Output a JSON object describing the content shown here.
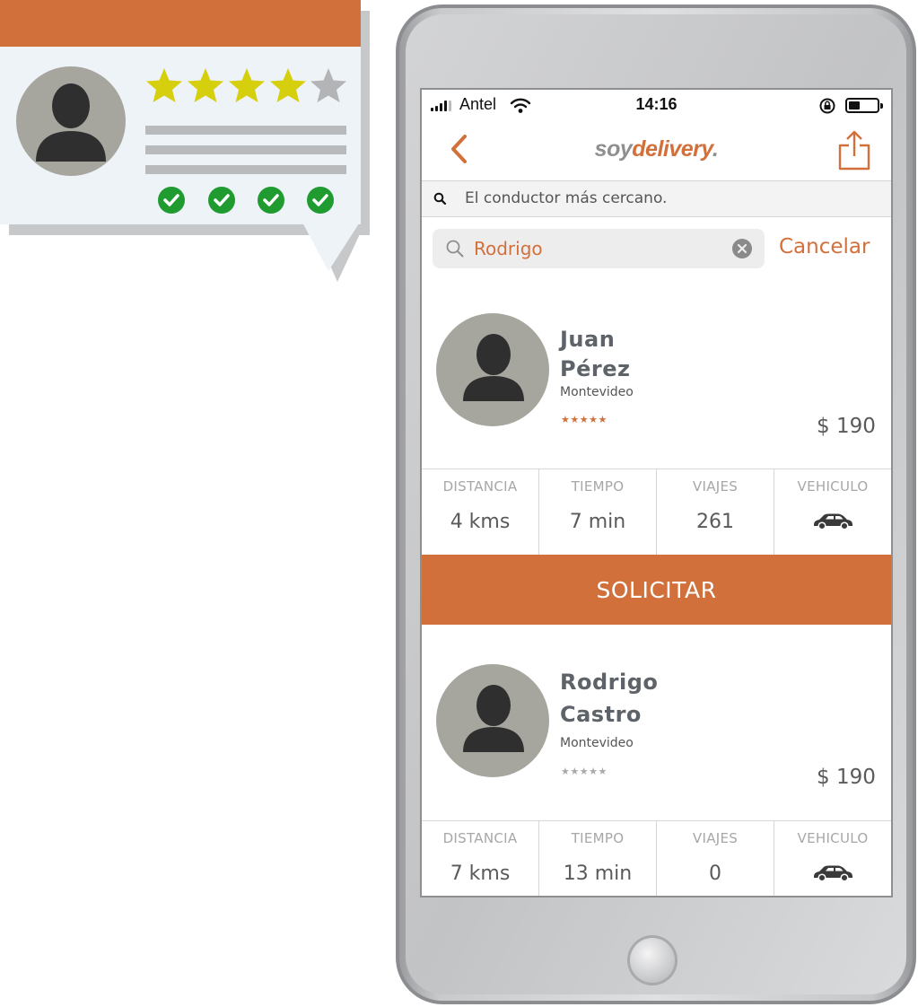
{
  "status_bar": {
    "carrier": "Antel",
    "time": "14:16"
  },
  "nav": {
    "logo_part1": "soy",
    "logo_part2": "delivery",
    "logo_mark": "."
  },
  "hint": {
    "text": "El conductor más cercano."
  },
  "search": {
    "value": "Rodrigo",
    "cancel_label": "Cancelar"
  },
  "drivers": [
    {
      "first_name": "Juan",
      "last_name": "Pérez",
      "city": "Montevideo",
      "rating": 5,
      "stars_text": "★★★★★",
      "star_color": "#d2703c",
      "price": "$ 190",
      "stats": [
        {
          "label": "DISTANCIA",
          "value": "4 kms"
        },
        {
          "label": "TIEMPO",
          "value": "7 min"
        },
        {
          "label": "VIAJES",
          "value": "261"
        },
        {
          "label": "VEHICULO",
          "icon": "car-icon"
        }
      ]
    },
    {
      "first_name": "Rodrigo",
      "last_name": "Castro",
      "city": "Montevideo",
      "rating": 0,
      "stars_text": "★★★★★",
      "star_color": "#a9a9a9",
      "price": "$ 190",
      "stats": [
        {
          "label": "DISTANCIA",
          "value": "7 kms"
        },
        {
          "label": "TIEMPO",
          "value": "13 min"
        },
        {
          "label": "VIAJES",
          "value": "0"
        },
        {
          "label": "VEHICULO",
          "icon": "car-icon"
        }
      ]
    }
  ],
  "request_button": {
    "label": "SOLICITAR"
  },
  "review_card": {
    "rating": 4,
    "max_rating": 5,
    "check_count": 4,
    "header_color": "#d2703c",
    "star_color": "#d6cf0e",
    "check_color": "#1f9b30"
  },
  "colors": {
    "accent": "#d2703c",
    "avatar_bg": "#a6a69f",
    "silhouette": "#2f2f2f"
  }
}
